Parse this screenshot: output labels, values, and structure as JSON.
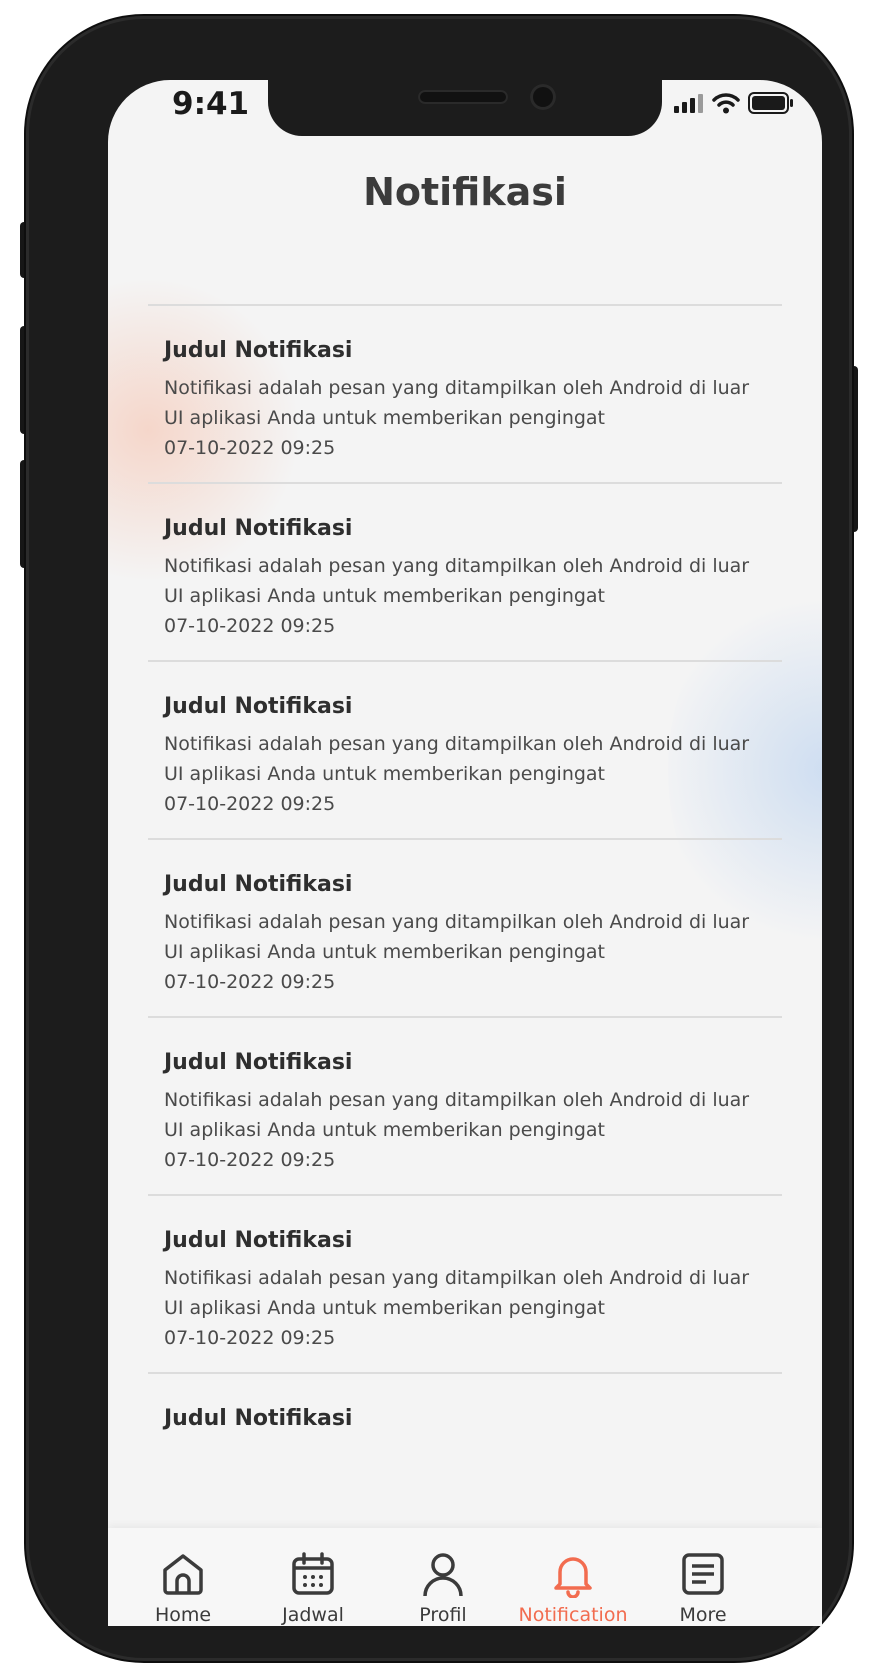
{
  "status_bar": {
    "time": "9:41"
  },
  "header": {
    "title": "Notifikasi"
  },
  "notifications": [
    {
      "title": "Judul Notifikasi",
      "body": "Notifikasi adalah pesan yang ditampilkan oleh Android di luar UI aplikasi Anda untuk memberikan pengingat",
      "date": "07-10-2022 09:25"
    },
    {
      "title": "Judul Notifikasi",
      "body": "Notifikasi adalah pesan yang ditampilkan oleh Android di luar UI aplikasi Anda untuk memberikan pengingat",
      "date": "07-10-2022 09:25"
    },
    {
      "title": "Judul Notifikasi",
      "body": "Notifikasi adalah pesan yang ditampilkan oleh Android di luar UI aplikasi Anda untuk memberikan pengingat",
      "date": "07-10-2022 09:25"
    },
    {
      "title": "Judul Notifikasi",
      "body": "Notifikasi adalah pesan yang ditampilkan oleh Android di luar UI aplikasi Anda untuk memberikan pengingat",
      "date": "07-10-2022 09:25"
    },
    {
      "title": "Judul Notifikasi",
      "body": "Notifikasi adalah pesan yang ditampilkan oleh Android di luar UI aplikasi Anda untuk memberikan pengingat",
      "date": "07-10-2022 09:25"
    },
    {
      "title": "Judul Notifikasi",
      "body": "Notifikasi adalah pesan yang ditampilkan oleh Android di luar UI aplikasi Anda untuk memberikan pengingat",
      "date": "07-10-2022 09:25"
    },
    {
      "title": "Judul Notifikasi"
    }
  ],
  "tabbar": {
    "items": [
      {
        "label": "Home",
        "icon": "home-icon"
      },
      {
        "label": "Jadwal",
        "icon": "calendar-icon"
      },
      {
        "label": "Profil",
        "icon": "person-icon"
      },
      {
        "label": "Notification",
        "icon": "bell-icon",
        "active": true
      },
      {
        "label": "More",
        "icon": "document-icon"
      }
    ]
  },
  "colors": {
    "accent": "#f26c4f",
    "text": "#3b3b3b",
    "background": "#f4f4f4"
  }
}
